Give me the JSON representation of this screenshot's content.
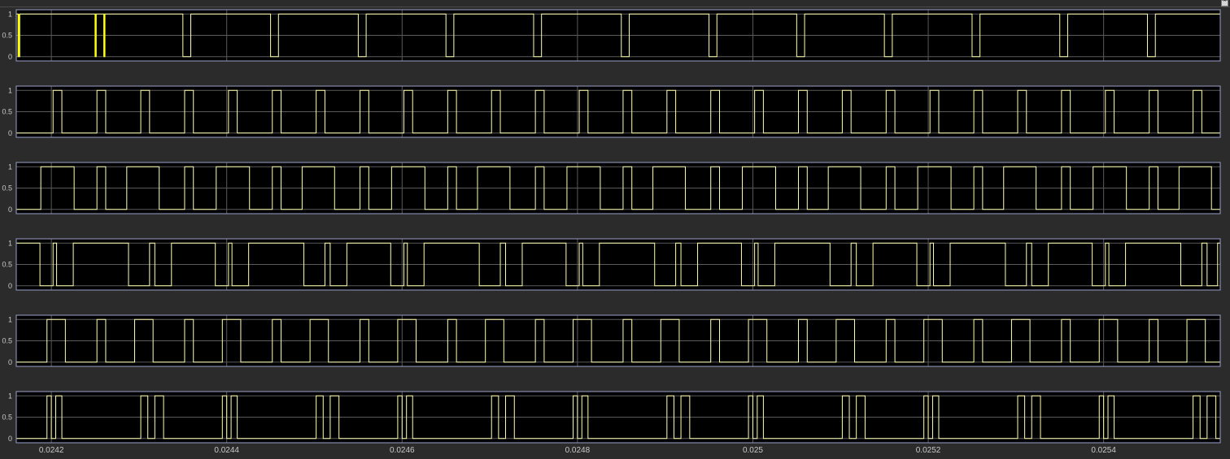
{
  "window": {
    "restore_icon": "restore-axes-icon"
  },
  "colors": {
    "background": "#2b2b2b",
    "axes_background": "#000000",
    "axes_border": "#9aa0c8",
    "grid": "#5a5a5a",
    "tick_label": "#c8c8c8",
    "signal": "#ffffb0",
    "signal_highlight": "#ffff00"
  },
  "chart_data": [
    {
      "type": "line",
      "step": true,
      "grid": true,
      "xlim": [
        0.02416,
        0.025533
      ],
      "ylim": [
        -0.1,
        1.1
      ],
      "yticks": [
        {
          "v": 1,
          "label": "1"
        },
        {
          "v": 0.5,
          "label": "0.5"
        },
        {
          "v": 0,
          "label": "0"
        }
      ],
      "series": [
        {
          "x0_value": 1,
          "transitions": [
            0.024162,
            0.024164,
            0.02425,
            0.024251,
            0.02426,
            0.024261,
            0.02435,
            0.024359,
            0.02445,
            0.024459,
            0.02455,
            0.024559,
            0.02465,
            0.024659,
            0.02475,
            0.024759,
            0.02485,
            0.024859,
            0.02495,
            0.024959,
            0.02505,
            0.025059,
            0.02515,
            0.025159,
            0.02525,
            0.025259,
            0.02535,
            0.025359,
            0.02545,
            0.025459
          ],
          "highlight": [
            0.024163,
            0.0242505,
            0.0242605
          ]
        }
      ]
    },
    {
      "type": "line",
      "step": true,
      "grid": true,
      "xlim": [
        0.02416,
        0.025533
      ],
      "ylim": [
        -0.1,
        1.1
      ],
      "yticks": [
        {
          "v": 1,
          "label": "1"
        },
        {
          "v": 0.5,
          "label": "0.5"
        },
        {
          "v": 0,
          "label": "0"
        }
      ],
      "series": [
        {
          "x0_value": 0,
          "transitions": [
            0.024202,
            0.024212,
            0.024252,
            0.024262,
            0.024302,
            0.024312,
            0.024352,
            0.024362,
            0.024402,
            0.024412,
            0.024452,
            0.024462,
            0.024502,
            0.024512,
            0.024552,
            0.024562,
            0.024602,
            0.024612,
            0.024652,
            0.024662,
            0.024702,
            0.024712,
            0.024752,
            0.024762,
            0.024802,
            0.024812,
            0.024852,
            0.024862,
            0.024902,
            0.024912,
            0.024952,
            0.024962,
            0.025002,
            0.025012,
            0.025052,
            0.025062,
            0.025102,
            0.025112,
            0.025152,
            0.025162,
            0.025202,
            0.025212,
            0.025252,
            0.025262,
            0.025302,
            0.025312,
            0.025352,
            0.025362,
            0.025402,
            0.025412,
            0.025452,
            0.025462,
            0.025502,
            0.025512
          ]
        }
      ]
    },
    {
      "type": "line",
      "step": true,
      "grid": true,
      "xlim": [
        0.02416,
        0.025533
      ],
      "ylim": [
        -0.1,
        1.1
      ],
      "yticks": [
        {
          "v": 1,
          "label": "1"
        },
        {
          "v": 0.5,
          "label": "0.5"
        },
        {
          "v": 0,
          "label": "0"
        }
      ],
      "series": [
        {
          "x0_value": 0,
          "transitions": [
            0.024188,
            0.024226,
            0.024252,
            0.024262,
            0.024286,
            0.024323,
            0.024352,
            0.024362,
            0.024388,
            0.024426,
            0.024452,
            0.024462,
            0.024486,
            0.024523,
            0.024552,
            0.024562,
            0.024588,
            0.024626,
            0.024652,
            0.024662,
            0.024686,
            0.024723,
            0.024752,
            0.024762,
            0.024788,
            0.024826,
            0.024852,
            0.024862,
            0.024886,
            0.024923,
            0.024952,
            0.024962,
            0.024988,
            0.025026,
            0.025052,
            0.025062,
            0.025086,
            0.025123,
            0.025152,
            0.025162,
            0.025188,
            0.025226,
            0.025252,
            0.025262,
            0.025286,
            0.025323,
            0.025352,
            0.025362,
            0.025388,
            0.025426,
            0.025452,
            0.025462,
            0.025486,
            0.025523
          ]
        }
      ]
    },
    {
      "type": "line",
      "step": true,
      "grid": true,
      "xlim": [
        0.02416,
        0.025533
      ],
      "ylim": [
        -0.1,
        1.1
      ],
      "yticks": [
        {
          "v": 1,
          "label": "1"
        },
        {
          "v": 0.5,
          "label": "0.5"
        },
        {
          "v": 0,
          "label": "0"
        }
      ],
      "series": [
        {
          "x0_value": 1,
          "transitions": [
            0.024187,
            0.024202,
            0.024206,
            0.024225,
            0.024288,
            0.024312,
            0.024318,
            0.024337,
            0.024387,
            0.024402,
            0.024406,
            0.024425,
            0.024488,
            0.024512,
            0.024518,
            0.024537,
            0.024587,
            0.024602,
            0.024606,
            0.024625,
            0.024688,
            0.024712,
            0.024718,
            0.024737,
            0.024787,
            0.024802,
            0.024806,
            0.024825,
            0.024888,
            0.024912,
            0.024918,
            0.024937,
            0.024987,
            0.025002,
            0.025006,
            0.025025,
            0.025088,
            0.025112,
            0.025118,
            0.025137,
            0.025187,
            0.025202,
            0.025206,
            0.025225,
            0.025288,
            0.025312,
            0.025318,
            0.025337,
            0.025387,
            0.025402,
            0.025406,
            0.025425,
            0.025488,
            0.025512,
            0.025518,
            0.02553
          ]
        }
      ]
    },
    {
      "type": "line",
      "step": true,
      "grid": true,
      "xlim": [
        0.02416,
        0.025533
      ],
      "ylim": [
        -0.1,
        1.1
      ],
      "yticks": [
        {
          "v": 1,
          "label": "1"
        },
        {
          "v": 0.5,
          "label": "0.5"
        },
        {
          "v": 0,
          "label": "0"
        }
      ],
      "series": [
        {
          "x0_value": 0,
          "transitions": [
            0.024195,
            0.024216,
            0.024252,
            0.024262,
            0.024295,
            0.024316,
            0.024352,
            0.024362,
            0.024395,
            0.024416,
            0.024452,
            0.024462,
            0.024495,
            0.024516,
            0.024552,
            0.024562,
            0.024595,
            0.024616,
            0.024652,
            0.024662,
            0.024695,
            0.024716,
            0.024752,
            0.024762,
            0.024795,
            0.024816,
            0.024852,
            0.024862,
            0.024895,
            0.024916,
            0.024952,
            0.024962,
            0.024995,
            0.025016,
            0.025052,
            0.025062,
            0.025095,
            0.025116,
            0.025152,
            0.025162,
            0.025195,
            0.025216,
            0.025252,
            0.025262,
            0.025295,
            0.025316,
            0.025352,
            0.025362,
            0.025395,
            0.025416,
            0.025452,
            0.025462,
            0.025495,
            0.025516
          ]
        }
      ]
    },
    {
      "type": "line",
      "step": true,
      "grid": true,
      "xlim": [
        0.02416,
        0.025533
      ],
      "ylim": [
        -0.1,
        1.1
      ],
      "yticks": [
        {
          "v": 1,
          "label": "1"
        },
        {
          "v": 0.5,
          "label": "0.5"
        },
        {
          "v": 0,
          "label": "0"
        }
      ],
      "xticks": [
        {
          "v": 0.0242,
          "label": "0.0242"
        },
        {
          "v": 0.0244,
          "label": "0.0244"
        },
        {
          "v": 0.0246,
          "label": "0.0246"
        },
        {
          "v": 0.0248,
          "label": "0.0248"
        },
        {
          "v": 0.025,
          "label": "0.025"
        },
        {
          "v": 0.0252,
          "label": "0.0252"
        },
        {
          "v": 0.0254,
          "label": "0.0254"
        }
      ],
      "series": [
        {
          "x0_value": 0,
          "transitions": [
            0.024195,
            0.0242,
            0.024205,
            0.024212,
            0.024302,
            0.02431,
            0.024318,
            0.024328,
            0.024395,
            0.0244,
            0.024405,
            0.024412,
            0.024502,
            0.02451,
            0.024518,
            0.024528,
            0.024595,
            0.0246,
            0.024605,
            0.024612,
            0.024702,
            0.02471,
            0.024718,
            0.024728,
            0.024795,
            0.0248,
            0.024805,
            0.024812,
            0.024902,
            0.02491,
            0.024918,
            0.024928,
            0.024995,
            0.025,
            0.025005,
            0.025012,
            0.025102,
            0.02511,
            0.025118,
            0.025128,
            0.025195,
            0.0252,
            0.025205,
            0.025212,
            0.025302,
            0.02531,
            0.025318,
            0.025328,
            0.025395,
            0.0254,
            0.025405,
            0.025412,
            0.025502,
            0.02551,
            0.025518,
            0.025528
          ]
        }
      ]
    }
  ]
}
